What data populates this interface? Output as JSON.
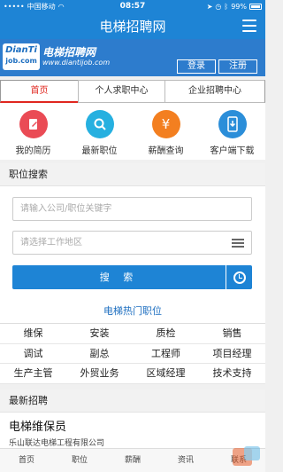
{
  "status_bar": {
    "carrier": "中国移动",
    "time": "08:57",
    "battery": "99%"
  },
  "header": {
    "title": "电梯招聘网"
  },
  "brand": {
    "logo_line1": "DianTi",
    "logo_line2": "job.com",
    "name": "电梯招聘网",
    "url": "www.diantijob.com",
    "login_label": "登录",
    "register_label": "注册"
  },
  "tabs": [
    {
      "label": "首页",
      "active": true
    },
    {
      "label": "个人求职中心",
      "active": false
    },
    {
      "label": "企业招聘中心",
      "active": false
    }
  ],
  "quick_links": [
    {
      "label": "我的简历",
      "icon": "pencil-icon",
      "color": "#ea4b55"
    },
    {
      "label": "最新职位",
      "icon": "search-icon",
      "color": "#26b0e0"
    },
    {
      "label": "薪酬查询",
      "icon": "yuan-icon",
      "color": "#f37f20"
    },
    {
      "label": "客户端下载",
      "icon": "phone-download-icon",
      "color": "#2b8ed9"
    }
  ],
  "search": {
    "section_title": "职位搜索",
    "keyword_placeholder": "请输入公司/职位关键字",
    "region_placeholder": "请选择工作地区",
    "button_label": "搜 索"
  },
  "hot_jobs": {
    "title": "电梯热门职位",
    "items": [
      "维保",
      "安装",
      "质检",
      "销售",
      "调试",
      "副总",
      "工程师",
      "项目经理",
      "生产主管",
      "外贸业务",
      "区域经理",
      "技术支持"
    ]
  },
  "latest": {
    "section_title": "最新招聘",
    "job_title": "电梯维保员",
    "company": "乐山联达电梯工程有限公司"
  },
  "bottom_nav": [
    "首页",
    "职位",
    "薪酬",
    "资讯",
    "联系"
  ],
  "colors": {
    "primary": "#1e84d5",
    "active_tab": "#e0271f"
  }
}
